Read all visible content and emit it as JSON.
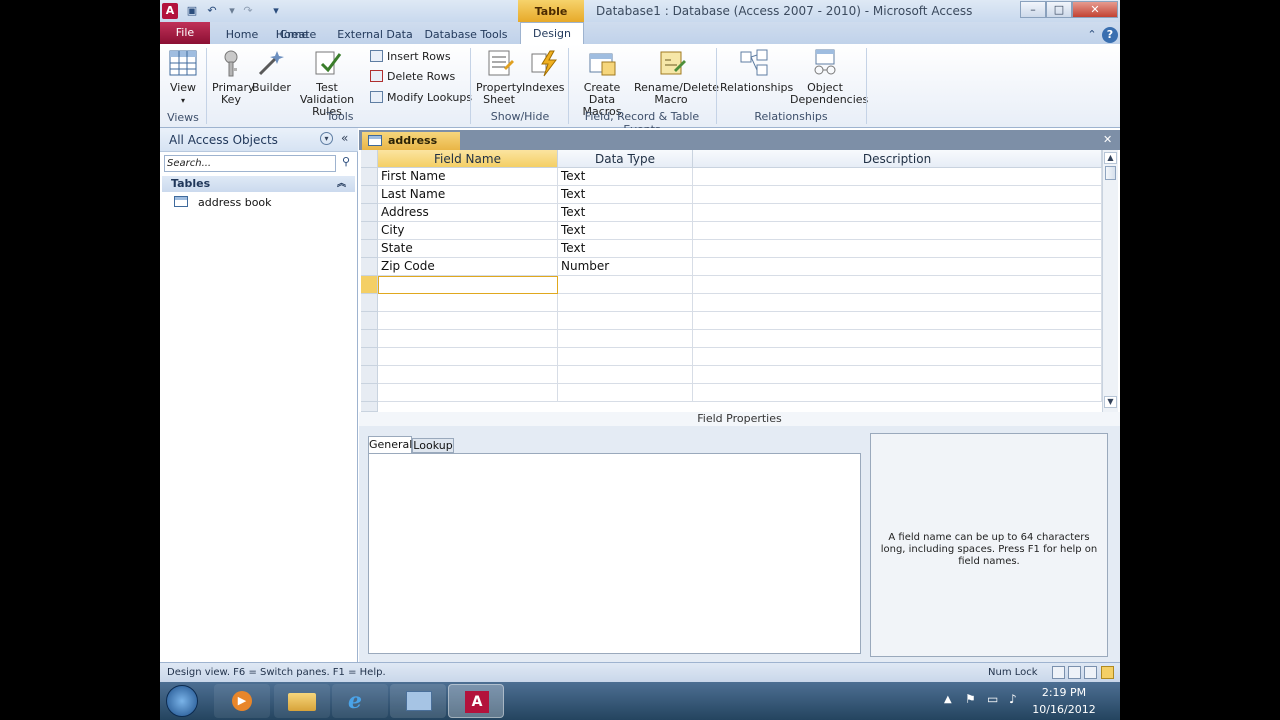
{
  "window": {
    "title": "Database1 : Database (Access 2007 - 2010)  -  Microsoft Access",
    "context_tab_group": "Table Tools",
    "controls": {
      "minimize": "–",
      "maximize": "□",
      "close": "✕"
    }
  },
  "ribbon_tabs": [
    "File",
    "Home",
    "Create",
    "External Data",
    "Database Tools",
    "Design"
  ],
  "active_tab": "Design",
  "ribbon": {
    "views": {
      "view_label": "View",
      "group": "Views"
    },
    "tools": {
      "primary_key": "Primary\nKey",
      "builder": "Builder",
      "test_validation": "Test Validation\nRules",
      "insert_rows": "Insert Rows",
      "delete_rows": "Delete Rows",
      "modify_lookups": "Modify Lookups",
      "group": "Tools"
    },
    "showhide": {
      "property_sheet": "Property\nSheet",
      "indexes": "Indexes",
      "group": "Show/Hide"
    },
    "events": {
      "create_data_macros": "Create Data\nMacros",
      "rename_delete_macro": "Rename/Delete\nMacro",
      "group": "Field, Record & Table Events"
    },
    "relationships": {
      "relationships": "Relationships",
      "object_dependencies": "Object\nDependencies",
      "group": "Relationships"
    }
  },
  "nav": {
    "title": "All Access Objects",
    "search_placeholder": "Search...",
    "section": "Tables",
    "items": [
      {
        "label": "address book",
        "icon": "table-icon"
      }
    ]
  },
  "document": {
    "tab_label": "address book",
    "columns": [
      "Field Name",
      "Data Type",
      "Description"
    ],
    "rows": [
      {
        "field": "First Name",
        "type": "Text",
        "description": ""
      },
      {
        "field": "Last Name",
        "type": "Text",
        "description": ""
      },
      {
        "field": "Address",
        "type": "Text",
        "description": ""
      },
      {
        "field": "City",
        "type": "Text",
        "description": ""
      },
      {
        "field": "State",
        "type": "Text",
        "description": ""
      },
      {
        "field": "Zip Code",
        "type": "Number",
        "description": ""
      }
    ],
    "field_properties_label": "Field Properties",
    "tabs": [
      "General",
      "Lookup"
    ],
    "help_text": "A field name can be up to 64 characters long, including spaces. Press F1 for help on field names."
  },
  "status": {
    "text": "Design view.   F6 = Switch panes.   F1 = Help.",
    "num_lock": "Num Lock"
  },
  "taskbar": {
    "time": "2:19 PM",
    "date": "10/16/2012"
  }
}
